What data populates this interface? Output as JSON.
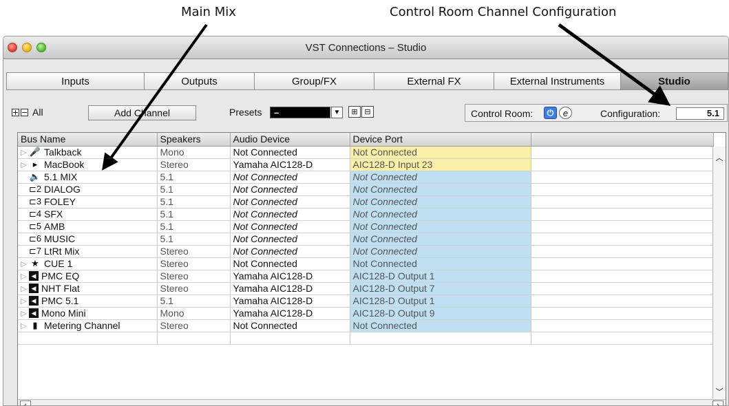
{
  "annotations": {
    "main_mix": "Main Mix",
    "control_room": "Control Room Channel Configuration"
  },
  "window": {
    "title": "VST Connections – Studio"
  },
  "tabs": [
    {
      "label": "Inputs",
      "active": false
    },
    {
      "label": "Outputs",
      "active": false
    },
    {
      "label": "Group/FX",
      "active": false
    },
    {
      "label": "External FX",
      "active": false
    },
    {
      "label": "External Instruments",
      "active": false
    },
    {
      "label": "Studio",
      "active": true
    }
  ],
  "toolbar": {
    "all_label": "All",
    "add_channel": "Add Channel",
    "presets_label": "Presets",
    "presets_value": "–",
    "control_room_label": "Control Room:",
    "configuration_label": "Configuration:",
    "configuration_value": "5.1"
  },
  "table": {
    "columns": [
      "Bus Name",
      "Speakers",
      "Audio Device",
      "Device Port"
    ],
    "rows": [
      {
        "name": "Talkback",
        "icon": "microphone-icon",
        "glyph": "🎤",
        "speakers": "Mono",
        "device": "Not Connected",
        "port": "Not Connected",
        "port_color": "yellow",
        "expandable": true,
        "italic": false
      },
      {
        "name": "MacBook",
        "icon": "play-monitor-icon",
        "glyph": "▸",
        "speakers": "Stereo",
        "device": "Yamaha AIC128-D",
        "port": "AIC128-D Input 23",
        "port_color": "yellow",
        "expandable": true,
        "italic": false
      },
      {
        "name": "5.1 MIX",
        "icon": "speaker-red-icon",
        "glyph": "🔈",
        "speakers": "5.1",
        "device": "Not Connected",
        "port": "Not Connected",
        "port_color": "blue",
        "expandable": false,
        "italic": true
      },
      {
        "name": "DIALOG",
        "icon": "downmix-2-icon",
        "glyph": "⊏2",
        "speakers": "5.1",
        "device": "Not Connected",
        "port": "Not Connected",
        "port_color": "blue",
        "expandable": false,
        "italic": true
      },
      {
        "name": "FOLEY",
        "icon": "downmix-3-icon",
        "glyph": "⊏3",
        "speakers": "5.1",
        "device": "Not Connected",
        "port": "Not Connected",
        "port_color": "blue",
        "expandable": false,
        "italic": true
      },
      {
        "name": "SFX",
        "icon": "downmix-4-icon",
        "glyph": "⊏4",
        "speakers": "5.1",
        "device": "Not Connected",
        "port": "Not Connected",
        "port_color": "blue",
        "expandable": false,
        "italic": true
      },
      {
        "name": "AMB",
        "icon": "downmix-5-icon",
        "glyph": "⊏5",
        "speakers": "5.1",
        "device": "Not Connected",
        "port": "Not Connected",
        "port_color": "blue",
        "expandable": false,
        "italic": true
      },
      {
        "name": "MUSIC",
        "icon": "downmix-6-icon",
        "glyph": "⊏6",
        "speakers": "5.1",
        "device": "Not Connected",
        "port": "Not Connected",
        "port_color": "blue",
        "expandable": false,
        "italic": true
      },
      {
        "name": "LtRt Mix",
        "icon": "downmix-7-icon",
        "glyph": "⊏7",
        "speakers": "Stereo",
        "device": "Not Connected",
        "port": "Not Connected",
        "port_color": "blue",
        "expandable": false,
        "italic": true
      },
      {
        "name": "CUE 1",
        "icon": "star-icon",
        "glyph": "★",
        "speakers": "Stereo",
        "device": "Not Connected",
        "port": "Not Connected",
        "port_color": "blue",
        "expandable": true,
        "italic": false
      },
      {
        "name": "PMC EQ",
        "icon": "speaker-black-icon",
        "glyph": "◀",
        "speakers": "Stereo",
        "device": "Yamaha AIC128-D",
        "port": "AIC128-D Output 1",
        "port_color": "blue",
        "expandable": true,
        "italic": false
      },
      {
        "name": "NHT Flat",
        "icon": "speaker-black-icon",
        "glyph": "◀",
        "speakers": "Stereo",
        "device": "Yamaha AIC128-D",
        "port": "AIC128-D Output 7",
        "port_color": "blue",
        "expandable": true,
        "italic": false
      },
      {
        "name": "PMC 5.1",
        "icon": "speaker-black-icon",
        "glyph": "◀",
        "speakers": "5.1",
        "device": "Yamaha AIC128-D",
        "port": "AIC128-D Output 1",
        "port_color": "blue",
        "expandable": true,
        "italic": false
      },
      {
        "name": "Mono Mini",
        "icon": "speaker-black-icon",
        "glyph": "◀",
        "speakers": "Mono",
        "device": "Yamaha AIC128-D",
        "port": "AIC128-D Output 9",
        "port_color": "blue",
        "expandable": true,
        "italic": false
      },
      {
        "name": "Metering Channel",
        "icon": "meter-icon",
        "glyph": "▮",
        "speakers": "Stereo",
        "device": "Not Connected",
        "port": "Not Connected",
        "port_color": "blue",
        "expandable": true,
        "italic": false
      }
    ]
  }
}
